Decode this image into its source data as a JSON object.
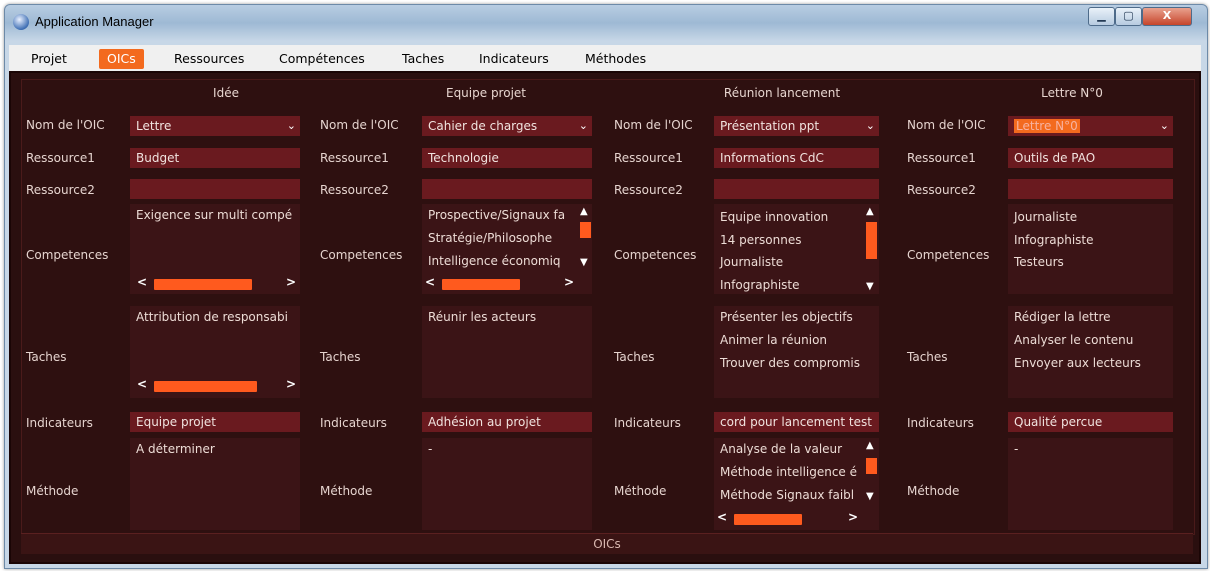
{
  "window": {
    "title": "Application Manager",
    "controls": {
      "min": "▁",
      "max": "▢",
      "close": "X"
    }
  },
  "menu": [
    "Projet",
    "OICs",
    "Ressources",
    "Compétences",
    "Taches",
    "Indicateurs",
    "Méthodes"
  ],
  "active_menu": "OICs",
  "row_labels": {
    "nom": "Nom de l'OIC",
    "ressource1": "Ressource1",
    "ressource2": "Ressource2",
    "competences": "Competences",
    "taches": "Taches",
    "indicateurs": "Indicateurs",
    "methode": "Méthode"
  },
  "columns": [
    {
      "header": "Idée",
      "nom": "Lettre",
      "ressource1": "Budget",
      "ressource2": "",
      "competences": [
        "Exigence sur multi compé"
      ],
      "taches": [
        "Attribution de responsabi"
      ],
      "indicateurs": "Equipe projet",
      "methode": [
        "A déterminer"
      ]
    },
    {
      "header": "Equipe projet",
      "nom": "Cahier de charges",
      "ressource1": "Technologie",
      "ressource2": "",
      "competences": [
        "Prospective/Signaux fa",
        "Stratégie/Philosophe",
        "Intelligence économiq"
      ],
      "taches": [
        "Réunir les acteurs"
      ],
      "indicateurs": "Adhésion au projet",
      "methode": [
        "-"
      ]
    },
    {
      "header": "Réunion lancement",
      "nom": "Présentation ppt",
      "ressource1": "Informations CdC",
      "ressource2": "",
      "competences": [
        "Equipe innovation",
        "14 personnes",
        "Journaliste",
        "Infographiste"
      ],
      "taches": [
        "Présenter les objectifs",
        "Animer la réunion",
        "Trouver des compromis"
      ],
      "indicateurs": "cord pour lancement test",
      "methode": [
        "Analyse de la valeur",
        "Méthode intelligence é",
        "Méthode Signaux faibl"
      ]
    },
    {
      "header": "Lettre N°0",
      "nom": "Lettre N°0",
      "ressource1": "Outils de PAO",
      "ressource2": "",
      "competences": [
        "Journaliste",
        "Infographiste",
        "Testeurs"
      ],
      "taches": [
        "Rédiger la lettre",
        "Analyser le contenu",
        "Envoyer aux lecteurs"
      ],
      "indicateurs": "Qualité percue",
      "methode": [
        "-"
      ]
    }
  ],
  "footer": "OICs",
  "scroll_arrows": {
    "left": "<",
    "right": ">",
    "up": "▲",
    "down": "▼"
  },
  "dropdown_arrow": "⌄",
  "colors": {
    "accent": "#f36a1e",
    "field": "#6a1a1f",
    "panel": "#2e1010"
  }
}
